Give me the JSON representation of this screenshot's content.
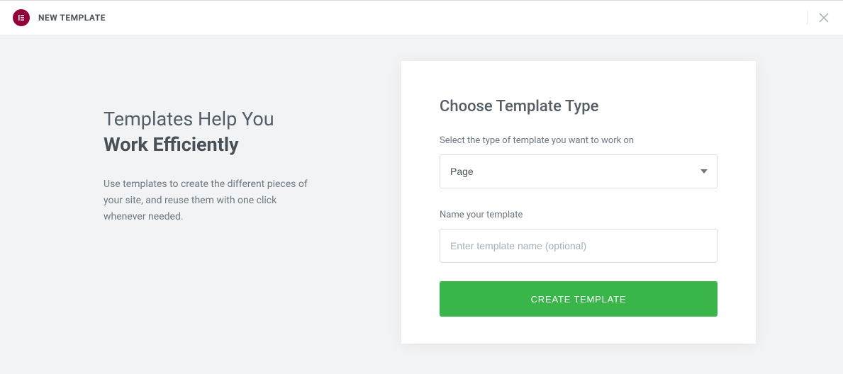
{
  "header": {
    "title": "NEW TEMPLATE"
  },
  "intro": {
    "headline_line1": "Templates Help You",
    "headline_line2": "Work Efficiently",
    "description": "Use templates to create the different pieces of your site, and reuse them with one click whenever needed."
  },
  "form": {
    "title": "Choose Template Type",
    "type_label": "Select the type of template you want to work on",
    "type_value": "Page",
    "name_label": "Name your template",
    "name_placeholder": "Enter template name (optional)",
    "submit_label": "CREATE TEMPLATE"
  }
}
